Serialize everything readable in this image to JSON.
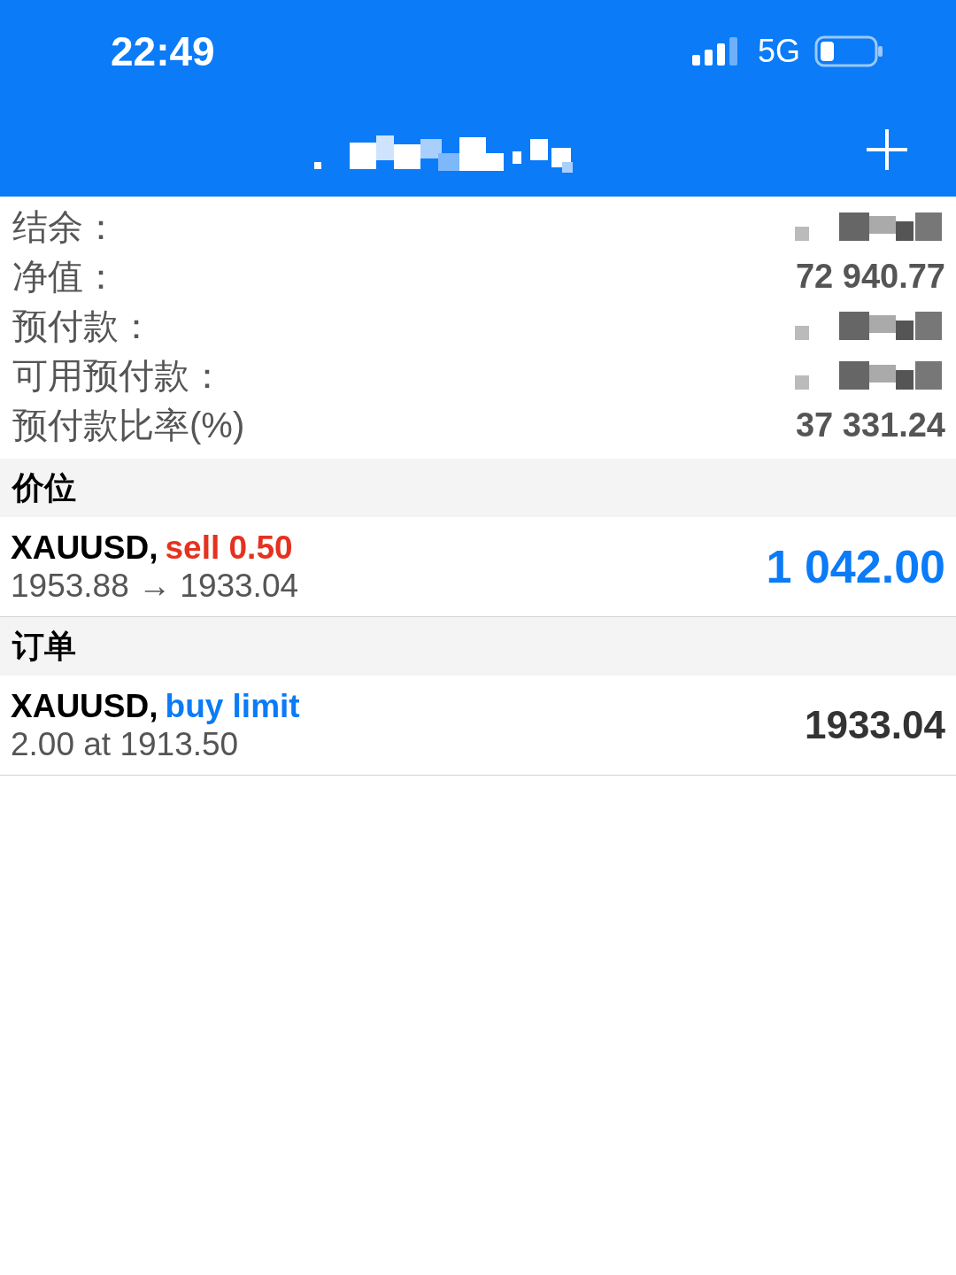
{
  "status_bar": {
    "time": "22:49",
    "network": "5G"
  },
  "account": [
    {
      "label": "结余：",
      "kind": "redacted"
    },
    {
      "label": "净值：",
      "kind": "text",
      "value": "72 940.77"
    },
    {
      "label": "预付款：",
      "kind": "redacted"
    },
    {
      "label": "可用预付款：",
      "kind": "redacted"
    },
    {
      "label": "预付款比率(%)",
      "kind": "text",
      "value": "37 331.24"
    }
  ],
  "positions": {
    "title": "价位",
    "items": [
      {
        "symbol": "XAUUSD,",
        "type": "sell 0.50",
        "color": "#e5321f",
        "detail": "1953.88 → 1933.04",
        "amount": "1 042.00",
        "kind": "position"
      }
    ]
  },
  "orders": {
    "title": "订单",
    "items": [
      {
        "symbol": "XAUUSD,",
        "type": "buy limit",
        "color": "#0b7bf7",
        "detail": "2.00 at 1913.50",
        "amount": "1933.04",
        "kind": "order"
      }
    ]
  }
}
